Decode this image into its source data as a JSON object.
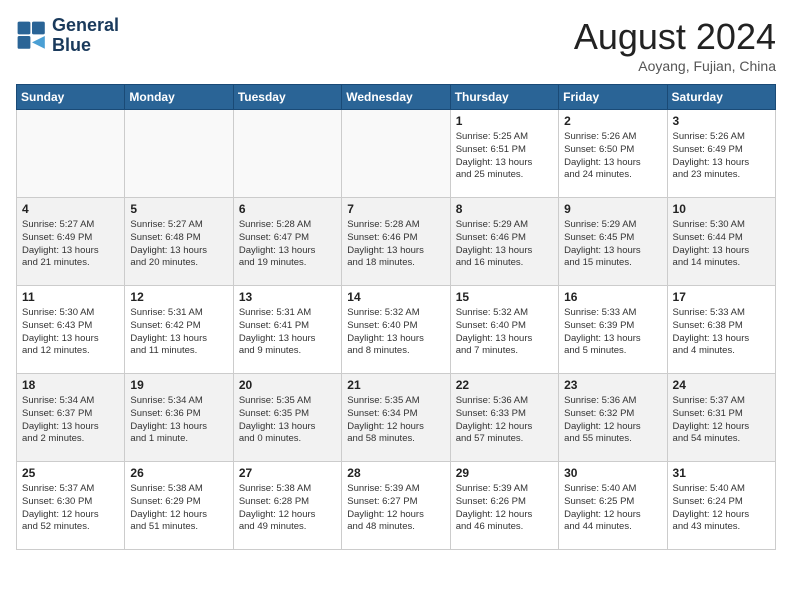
{
  "header": {
    "logo_line1": "General",
    "logo_line2": "Blue",
    "month_title": "August 2024",
    "location": "Aoyang, Fujian, China"
  },
  "weekdays": [
    "Sunday",
    "Monday",
    "Tuesday",
    "Wednesday",
    "Thursday",
    "Friday",
    "Saturday"
  ],
  "weeks": [
    [
      {
        "day": "",
        "info": ""
      },
      {
        "day": "",
        "info": ""
      },
      {
        "day": "",
        "info": ""
      },
      {
        "day": "",
        "info": ""
      },
      {
        "day": "1",
        "info": "Sunrise: 5:25 AM\nSunset: 6:51 PM\nDaylight: 13 hours\nand 25 minutes."
      },
      {
        "day": "2",
        "info": "Sunrise: 5:26 AM\nSunset: 6:50 PM\nDaylight: 13 hours\nand 24 minutes."
      },
      {
        "day": "3",
        "info": "Sunrise: 5:26 AM\nSunset: 6:49 PM\nDaylight: 13 hours\nand 23 minutes."
      }
    ],
    [
      {
        "day": "4",
        "info": "Sunrise: 5:27 AM\nSunset: 6:49 PM\nDaylight: 13 hours\nand 21 minutes."
      },
      {
        "day": "5",
        "info": "Sunrise: 5:27 AM\nSunset: 6:48 PM\nDaylight: 13 hours\nand 20 minutes."
      },
      {
        "day": "6",
        "info": "Sunrise: 5:28 AM\nSunset: 6:47 PM\nDaylight: 13 hours\nand 19 minutes."
      },
      {
        "day": "7",
        "info": "Sunrise: 5:28 AM\nSunset: 6:46 PM\nDaylight: 13 hours\nand 18 minutes."
      },
      {
        "day": "8",
        "info": "Sunrise: 5:29 AM\nSunset: 6:46 PM\nDaylight: 13 hours\nand 16 minutes."
      },
      {
        "day": "9",
        "info": "Sunrise: 5:29 AM\nSunset: 6:45 PM\nDaylight: 13 hours\nand 15 minutes."
      },
      {
        "day": "10",
        "info": "Sunrise: 5:30 AM\nSunset: 6:44 PM\nDaylight: 13 hours\nand 14 minutes."
      }
    ],
    [
      {
        "day": "11",
        "info": "Sunrise: 5:30 AM\nSunset: 6:43 PM\nDaylight: 13 hours\nand 12 minutes."
      },
      {
        "day": "12",
        "info": "Sunrise: 5:31 AM\nSunset: 6:42 PM\nDaylight: 13 hours\nand 11 minutes."
      },
      {
        "day": "13",
        "info": "Sunrise: 5:31 AM\nSunset: 6:41 PM\nDaylight: 13 hours\nand 9 minutes."
      },
      {
        "day": "14",
        "info": "Sunrise: 5:32 AM\nSunset: 6:40 PM\nDaylight: 13 hours\nand 8 minutes."
      },
      {
        "day": "15",
        "info": "Sunrise: 5:32 AM\nSunset: 6:40 PM\nDaylight: 13 hours\nand 7 minutes."
      },
      {
        "day": "16",
        "info": "Sunrise: 5:33 AM\nSunset: 6:39 PM\nDaylight: 13 hours\nand 5 minutes."
      },
      {
        "day": "17",
        "info": "Sunrise: 5:33 AM\nSunset: 6:38 PM\nDaylight: 13 hours\nand 4 minutes."
      }
    ],
    [
      {
        "day": "18",
        "info": "Sunrise: 5:34 AM\nSunset: 6:37 PM\nDaylight: 13 hours\nand 2 minutes."
      },
      {
        "day": "19",
        "info": "Sunrise: 5:34 AM\nSunset: 6:36 PM\nDaylight: 13 hours\nand 1 minute."
      },
      {
        "day": "20",
        "info": "Sunrise: 5:35 AM\nSunset: 6:35 PM\nDaylight: 13 hours\nand 0 minutes."
      },
      {
        "day": "21",
        "info": "Sunrise: 5:35 AM\nSunset: 6:34 PM\nDaylight: 12 hours\nand 58 minutes."
      },
      {
        "day": "22",
        "info": "Sunrise: 5:36 AM\nSunset: 6:33 PM\nDaylight: 12 hours\nand 57 minutes."
      },
      {
        "day": "23",
        "info": "Sunrise: 5:36 AM\nSunset: 6:32 PM\nDaylight: 12 hours\nand 55 minutes."
      },
      {
        "day": "24",
        "info": "Sunrise: 5:37 AM\nSunset: 6:31 PM\nDaylight: 12 hours\nand 54 minutes."
      }
    ],
    [
      {
        "day": "25",
        "info": "Sunrise: 5:37 AM\nSunset: 6:30 PM\nDaylight: 12 hours\nand 52 minutes."
      },
      {
        "day": "26",
        "info": "Sunrise: 5:38 AM\nSunset: 6:29 PM\nDaylight: 12 hours\nand 51 minutes."
      },
      {
        "day": "27",
        "info": "Sunrise: 5:38 AM\nSunset: 6:28 PM\nDaylight: 12 hours\nand 49 minutes."
      },
      {
        "day": "28",
        "info": "Sunrise: 5:39 AM\nSunset: 6:27 PM\nDaylight: 12 hours\nand 48 minutes."
      },
      {
        "day": "29",
        "info": "Sunrise: 5:39 AM\nSunset: 6:26 PM\nDaylight: 12 hours\nand 46 minutes."
      },
      {
        "day": "30",
        "info": "Sunrise: 5:40 AM\nSunset: 6:25 PM\nDaylight: 12 hours\nand 44 minutes."
      },
      {
        "day": "31",
        "info": "Sunrise: 5:40 AM\nSunset: 6:24 PM\nDaylight: 12 hours\nand 43 minutes."
      }
    ]
  ]
}
